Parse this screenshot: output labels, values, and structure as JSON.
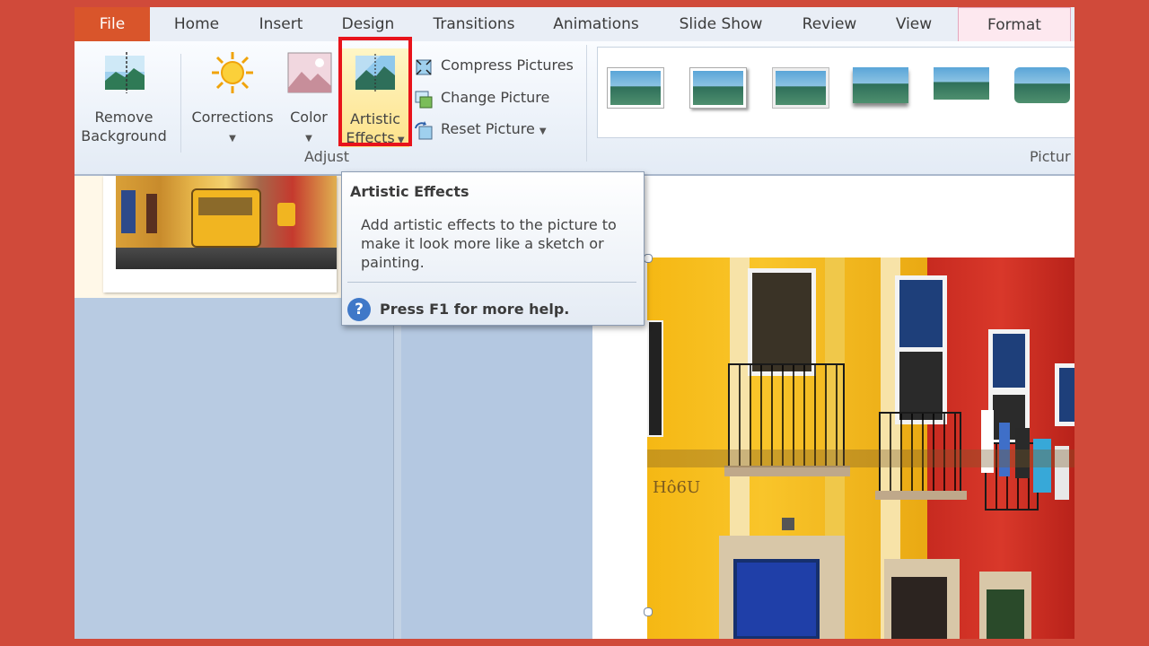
{
  "tabs": [
    {
      "label": "File"
    },
    {
      "label": "Home"
    },
    {
      "label": "Insert"
    },
    {
      "label": "Design"
    },
    {
      "label": "Transitions"
    },
    {
      "label": "Animations"
    },
    {
      "label": "Slide Show"
    },
    {
      "label": "Review"
    },
    {
      "label": "View"
    },
    {
      "label": "Format"
    }
  ],
  "ribbon": {
    "remove_background": {
      "line1": "Remove",
      "line2": "Background"
    },
    "corrections": "Corrections",
    "color": "Color",
    "artistic_effects": {
      "line1": "Artistic",
      "line2": "Effects"
    },
    "compress": "Compress Pictures",
    "change": "Change Picture",
    "reset": "Reset Picture",
    "group_adjust": "Adjust",
    "group_picture_styles": "Pictur"
  },
  "tooltip": {
    "title": "Artistic Effects",
    "body": "Add artistic effects to the picture to make it look more like a sketch or painting.",
    "help": "Press F1 for more help."
  },
  "photo": {
    "sign_text": "Hô6U"
  },
  "colors": {
    "file_tab": "#d9552b",
    "highlight": "#e8131b",
    "format_tab": "#fde8ef",
    "background": "#d04a3a"
  }
}
